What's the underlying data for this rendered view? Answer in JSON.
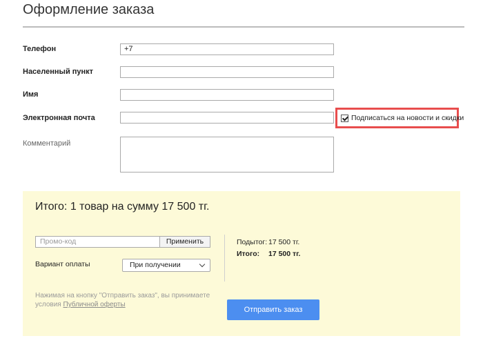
{
  "page": {
    "title": "Оформление заказа"
  },
  "form": {
    "phone": {
      "label": "Телефон",
      "value": "+7"
    },
    "city": {
      "label": "Населенный пункт",
      "value": ""
    },
    "name": {
      "label": "Имя",
      "value": ""
    },
    "email": {
      "label": "Электронная почта",
      "value": ""
    },
    "subscribe": {
      "label": "Подписаться на новости и скидки",
      "checked": true
    },
    "comment": {
      "label": "Комментарий",
      "value": ""
    }
  },
  "summary": {
    "heading": "Итого: 1 товар на сумму 17 500 тг.",
    "promo": {
      "placeholder": "Промо-код",
      "apply_label": "Применить"
    },
    "payment": {
      "label": "Вариант оплаты",
      "selected": "При получении"
    },
    "subtotal": {
      "label": "Подытог:",
      "value": "17 500 тг."
    },
    "total": {
      "label": "Итого:",
      "value": "17 500 тг."
    },
    "terms": {
      "text": "Нажимая на кнопку \"Отправить заказ\", вы принимаете условия",
      "link": "Публичной оферты"
    },
    "submit_label": "Отправить заказ"
  },
  "colors": {
    "accent": "#4c8ef0",
    "panel_bg": "#fdfad8",
    "highlight_border": "#e84d4d"
  }
}
